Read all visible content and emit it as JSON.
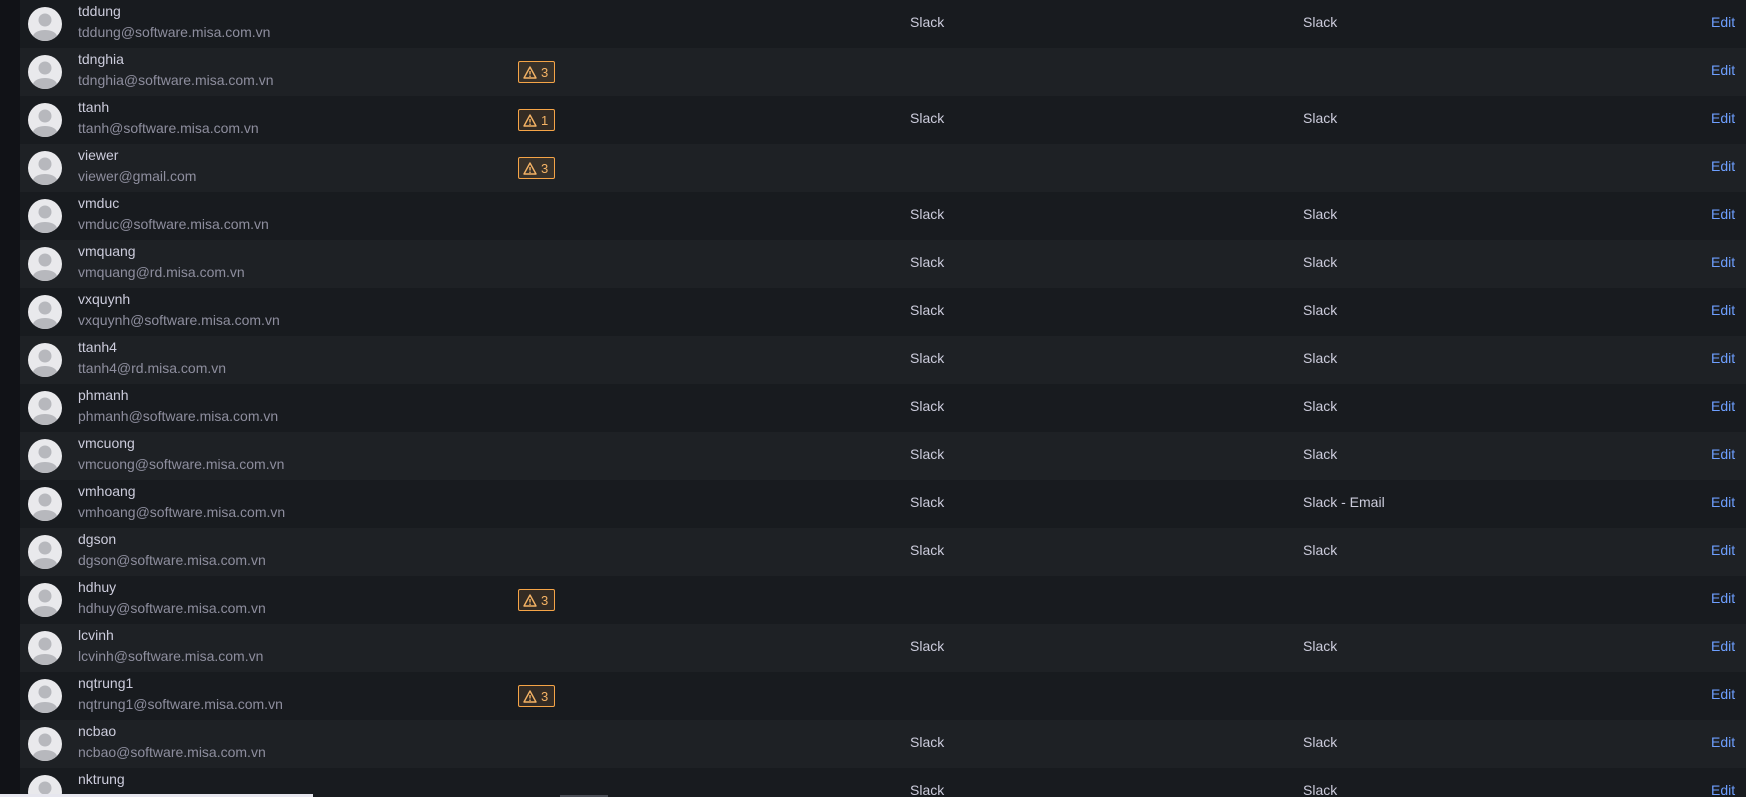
{
  "edit_label": "Edit",
  "badge_icon": "warning-triangle-icon",
  "colors": {
    "accent_link": "#6e9fff",
    "warning": "#f5a447"
  },
  "users": [
    {
      "login": "tddung",
      "email": "tddung@software.misa.com.vn",
      "warnings": "",
      "notify1": "Slack",
      "notify2": "Slack"
    },
    {
      "login": "tdnghia",
      "email": "tdnghia@software.misa.com.vn",
      "warnings": "3",
      "notify1": "",
      "notify2": ""
    },
    {
      "login": "ttanh",
      "email": "ttanh@software.misa.com.vn",
      "warnings": "1",
      "notify1": "Slack",
      "notify2": "Slack"
    },
    {
      "login": "viewer",
      "email": "viewer@gmail.com",
      "warnings": "3",
      "notify1": "",
      "notify2": ""
    },
    {
      "login": "vmduc",
      "email": "vmduc@software.misa.com.vn",
      "warnings": "",
      "notify1": "Slack",
      "notify2": "Slack"
    },
    {
      "login": "vmquang",
      "email": "vmquang@rd.misa.com.vn",
      "warnings": "",
      "notify1": "Slack",
      "notify2": "Slack"
    },
    {
      "login": "vxquynh",
      "email": "vxquynh@software.misa.com.vn",
      "warnings": "",
      "notify1": "Slack",
      "notify2": "Slack"
    },
    {
      "login": "ttanh4",
      "email": "ttanh4@rd.misa.com.vn",
      "warnings": "",
      "notify1": "Slack",
      "notify2": "Slack"
    },
    {
      "login": "phmanh",
      "email": "phmanh@software.misa.com.vn",
      "warnings": "",
      "notify1": "Slack",
      "notify2": "Slack"
    },
    {
      "login": "vmcuong",
      "email": "vmcuong@software.misa.com.vn",
      "warnings": "",
      "notify1": "Slack",
      "notify2": "Slack"
    },
    {
      "login": "vmhoang",
      "email": "vmhoang@software.misa.com.vn",
      "warnings": "",
      "notify1": "Slack",
      "notify2": "Slack - Email"
    },
    {
      "login": "dgson",
      "email": "dgson@software.misa.com.vn",
      "warnings": "",
      "notify1": "Slack",
      "notify2": "Slack"
    },
    {
      "login": "hdhuy",
      "email": "hdhuy@software.misa.com.vn",
      "warnings": "3",
      "notify1": "",
      "notify2": ""
    },
    {
      "login": "lcvinh",
      "email": "lcvinh@software.misa.com.vn",
      "warnings": "",
      "notify1": "Slack",
      "notify2": "Slack"
    },
    {
      "login": "nqtrung1",
      "email": "nqtrung1@software.misa.com.vn",
      "warnings": "3",
      "notify1": "",
      "notify2": ""
    },
    {
      "login": "ncbao",
      "email": "ncbao@software.misa.com.vn",
      "warnings": "",
      "notify1": "Slack",
      "notify2": "Slack"
    },
    {
      "login": "nktrung",
      "email": "",
      "warnings": "",
      "notify1": "Slack",
      "notify2": "Slack"
    }
  ]
}
